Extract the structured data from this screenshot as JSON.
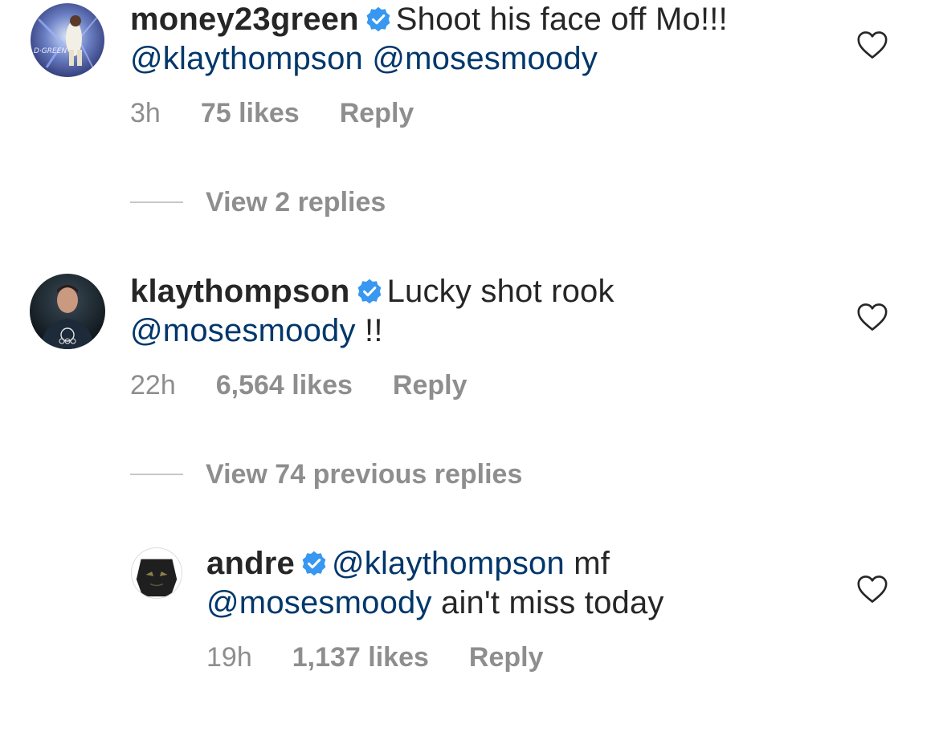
{
  "comments": [
    {
      "username": "money23green",
      "verified": true,
      "line1_text": "Shoot his face off Mo!!!",
      "line2_mention1": "@klaythompson",
      "line2_mention2": "@mosesmoody",
      "time": "3h",
      "likes": "75 likes",
      "reply": "Reply"
    },
    {
      "username": "klaythompson",
      "verified": true,
      "line1_text": "Lucky shot rook",
      "line2_mention": "@mosesmoody",
      "line2_text": "!!",
      "time": "22h",
      "likes": "6,564 likes",
      "reply": "Reply"
    },
    {
      "username": "andre",
      "verified": true,
      "line1_mention": "@klaythompson",
      "line1_text": "mf",
      "line2_mention": "@mosesmoody",
      "line2_text": "ain't miss today",
      "time": "19h",
      "likes": "1,137 likes",
      "reply": "Reply"
    }
  ],
  "view_replies": [
    {
      "label": "View 2 replies"
    },
    {
      "label": "View 74 previous replies"
    }
  ],
  "icons": {
    "verified": "verified-badge-icon",
    "like": "heart-outline-icon"
  },
  "colors": {
    "verified": "#3897f0",
    "mention": "#00376b",
    "meta": "#8e8e8e",
    "text": "#262626"
  }
}
